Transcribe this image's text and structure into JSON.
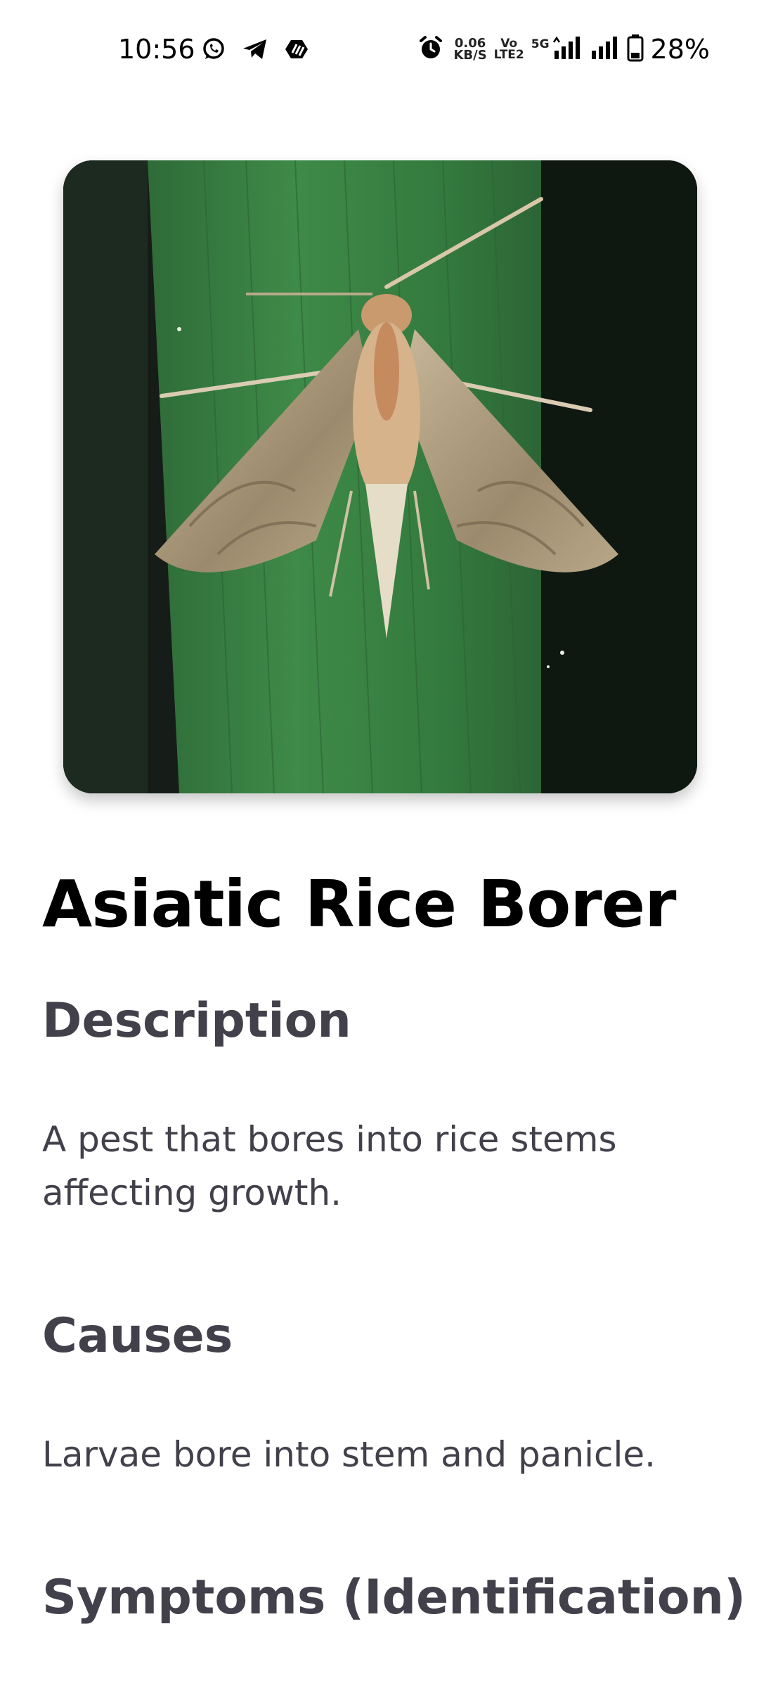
{
  "status_bar": {
    "time": "10:56",
    "left_icons": [
      "whatsapp-icon",
      "telegram-icon",
      "app-notification-icon"
    ],
    "alarm_icon": "alarm-icon",
    "net_speed_value": "0.06",
    "net_speed_unit": "KB/S",
    "volte_top": "Vo",
    "volte_bottom": "LTE2",
    "network_type": "5G",
    "battery": "28%"
  },
  "pest": {
    "image_alt": "Asiatic rice borer moth on a rice leaf",
    "name": "Asiatic Rice Borer",
    "sections": [
      {
        "heading": "Description",
        "text": "A pest that bores into rice stems affecting growth."
      },
      {
        "heading": "Causes",
        "text": "Larvae bore into stem and panicle."
      },
      {
        "heading": "Symptoms (Identification)",
        "text": ""
      }
    ]
  }
}
